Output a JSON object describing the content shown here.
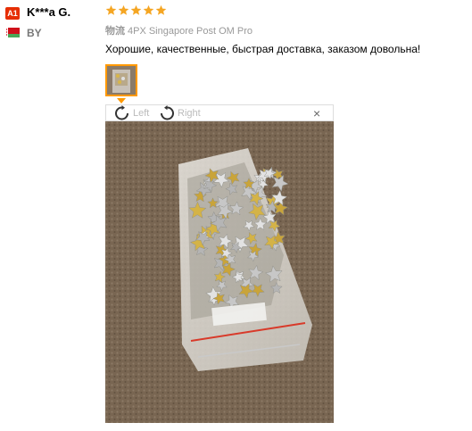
{
  "reviewer": {
    "level_badge": "A1",
    "name": "K***a G.",
    "country_code": "BY",
    "flag_colors": {
      "top": "#cf101a",
      "bottom": "#4aa657"
    }
  },
  "rating": {
    "stars": 5,
    "max": 5,
    "color": "#f5a623"
  },
  "shipping": {
    "label": "物流",
    "value": "4PX Singapore Post OM Pro"
  },
  "review_text": "Хорошие, качественные, быстрая доставка, заказом довольна!",
  "viewer": {
    "rotate_left": "Left",
    "rotate_right": "Right",
    "close": "×",
    "accent": "#f90"
  }
}
